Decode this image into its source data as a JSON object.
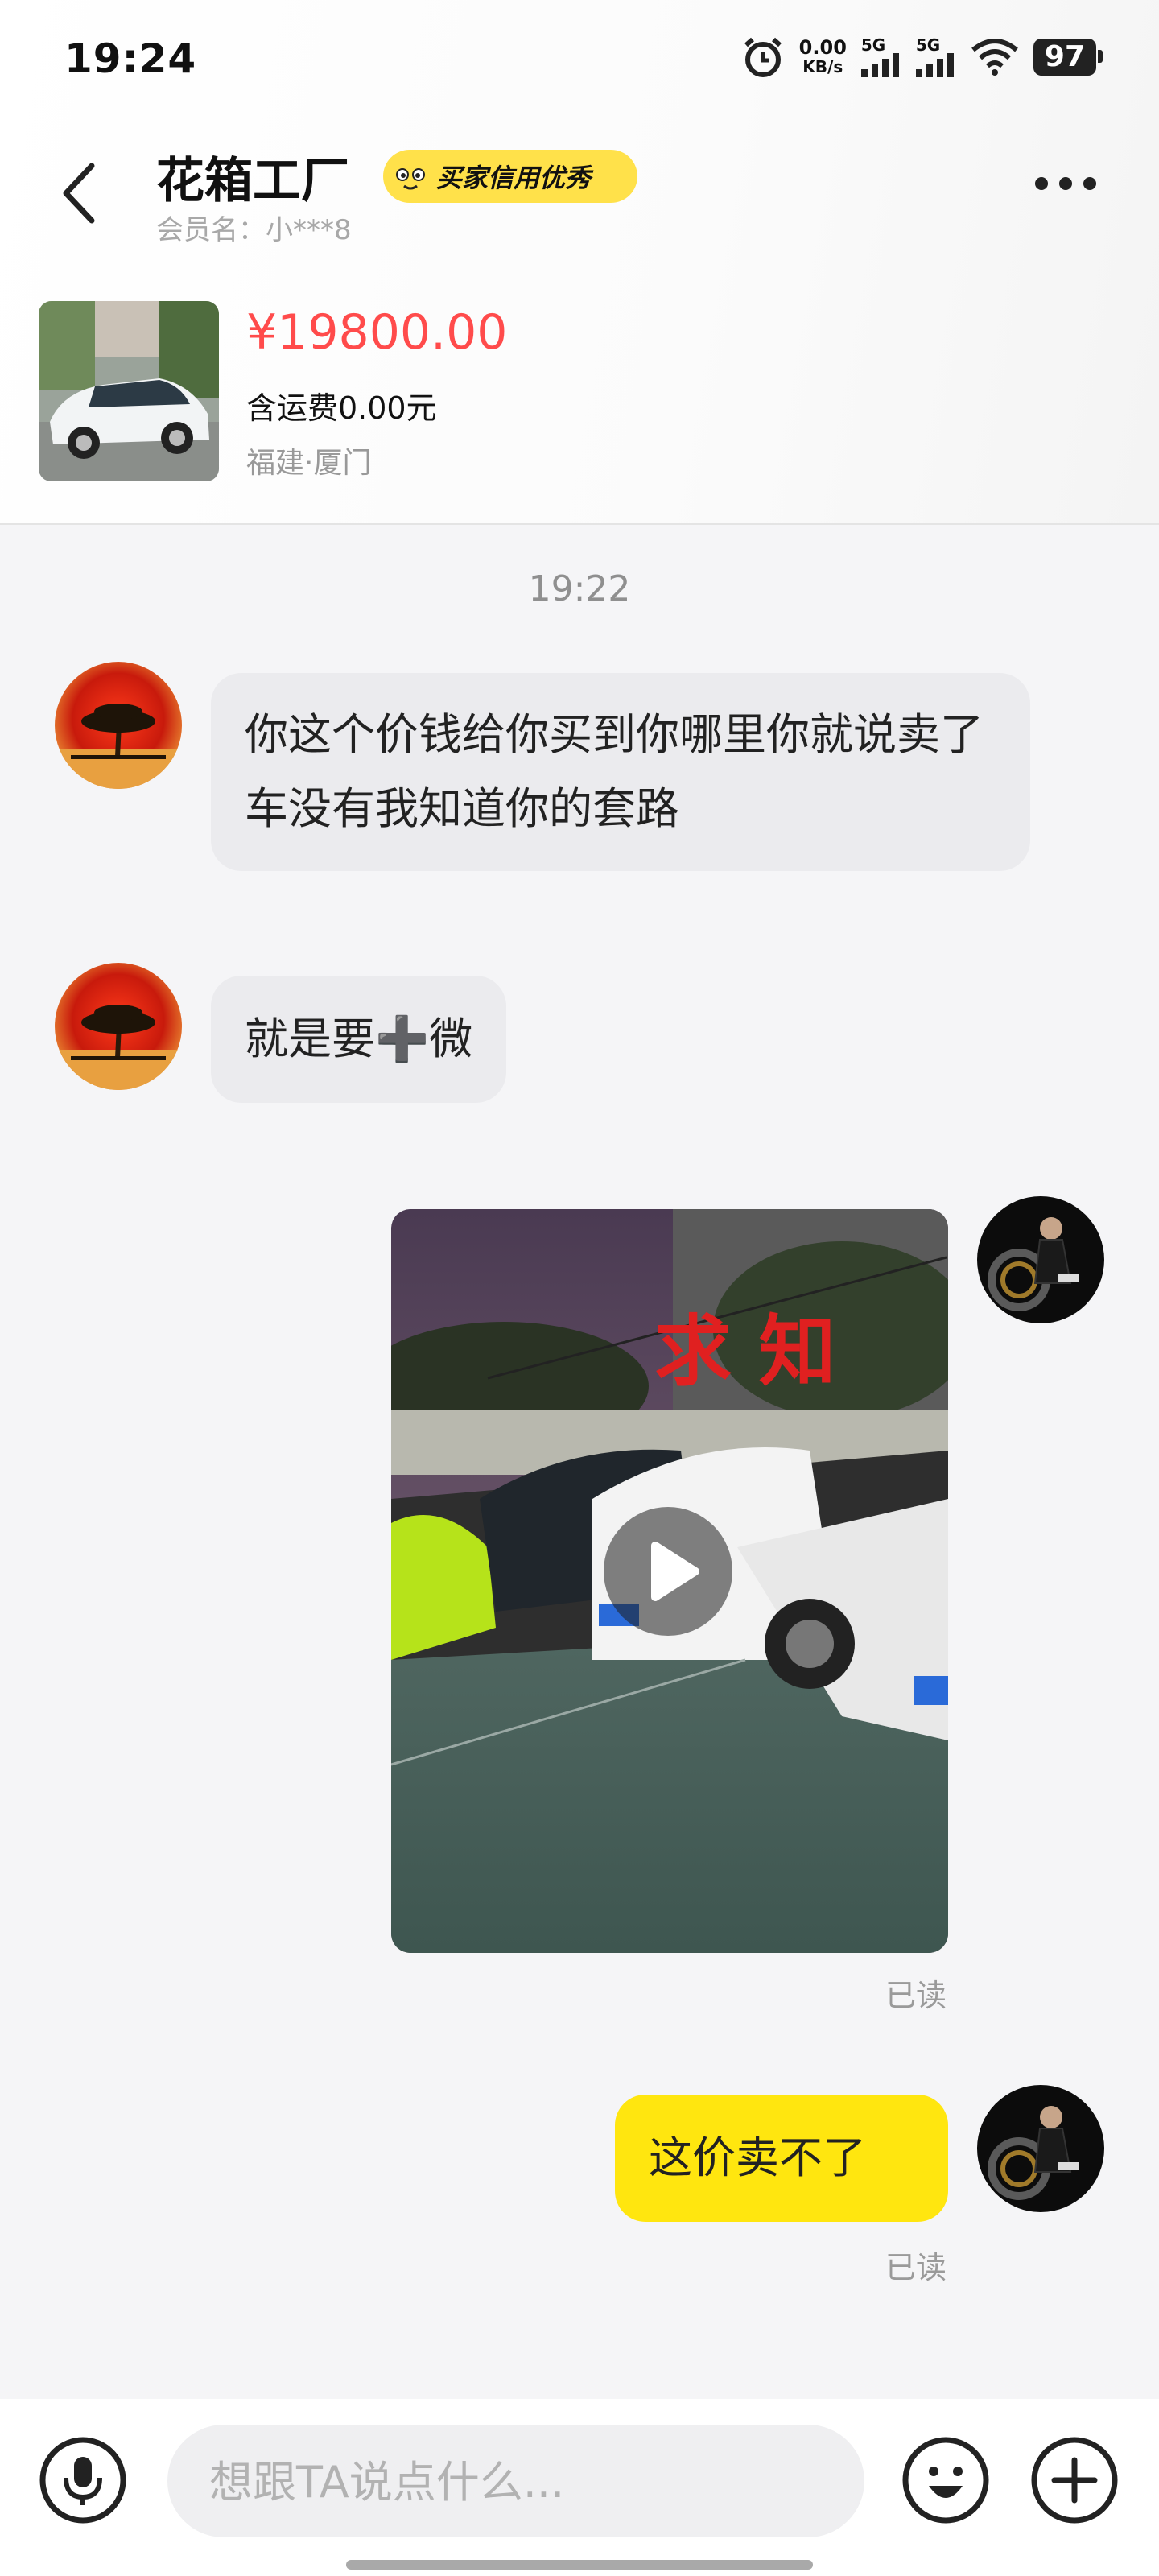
{
  "status_bar": {
    "time": "19:24",
    "net_speed_value": "0.00",
    "net_speed_unit": "KB/s",
    "signal_1_label": "5G",
    "signal_2_label": "5G",
    "battery": "97"
  },
  "header": {
    "shop_name": "花箱工厂",
    "credit_badge": "买家信用优秀",
    "member_name": "会员名：小***8"
  },
  "product": {
    "price": "¥19800.00",
    "shipping": "含运费0.00元",
    "location": "福建·厦门"
  },
  "chat": {
    "timestamp": "19:22",
    "messages": [
      {
        "side": "in",
        "text": "你这个价钱给你买到你哪里你就说卖了车没有我知道你的套路"
      },
      {
        "side": "in",
        "text": "就是要➕微"
      },
      {
        "side": "out",
        "type": "video",
        "sign_text": "求 知",
        "read_status": "已读"
      },
      {
        "side": "out",
        "text": "这价卖不了",
        "read_status": "已读"
      }
    ]
  },
  "input_bar": {
    "placeholder": "想跟TA说点什么..."
  },
  "colors": {
    "accent_yellow": "#ffe60f",
    "price_red": "#ff4b4b",
    "incoming_bubble": "#ebebee"
  }
}
